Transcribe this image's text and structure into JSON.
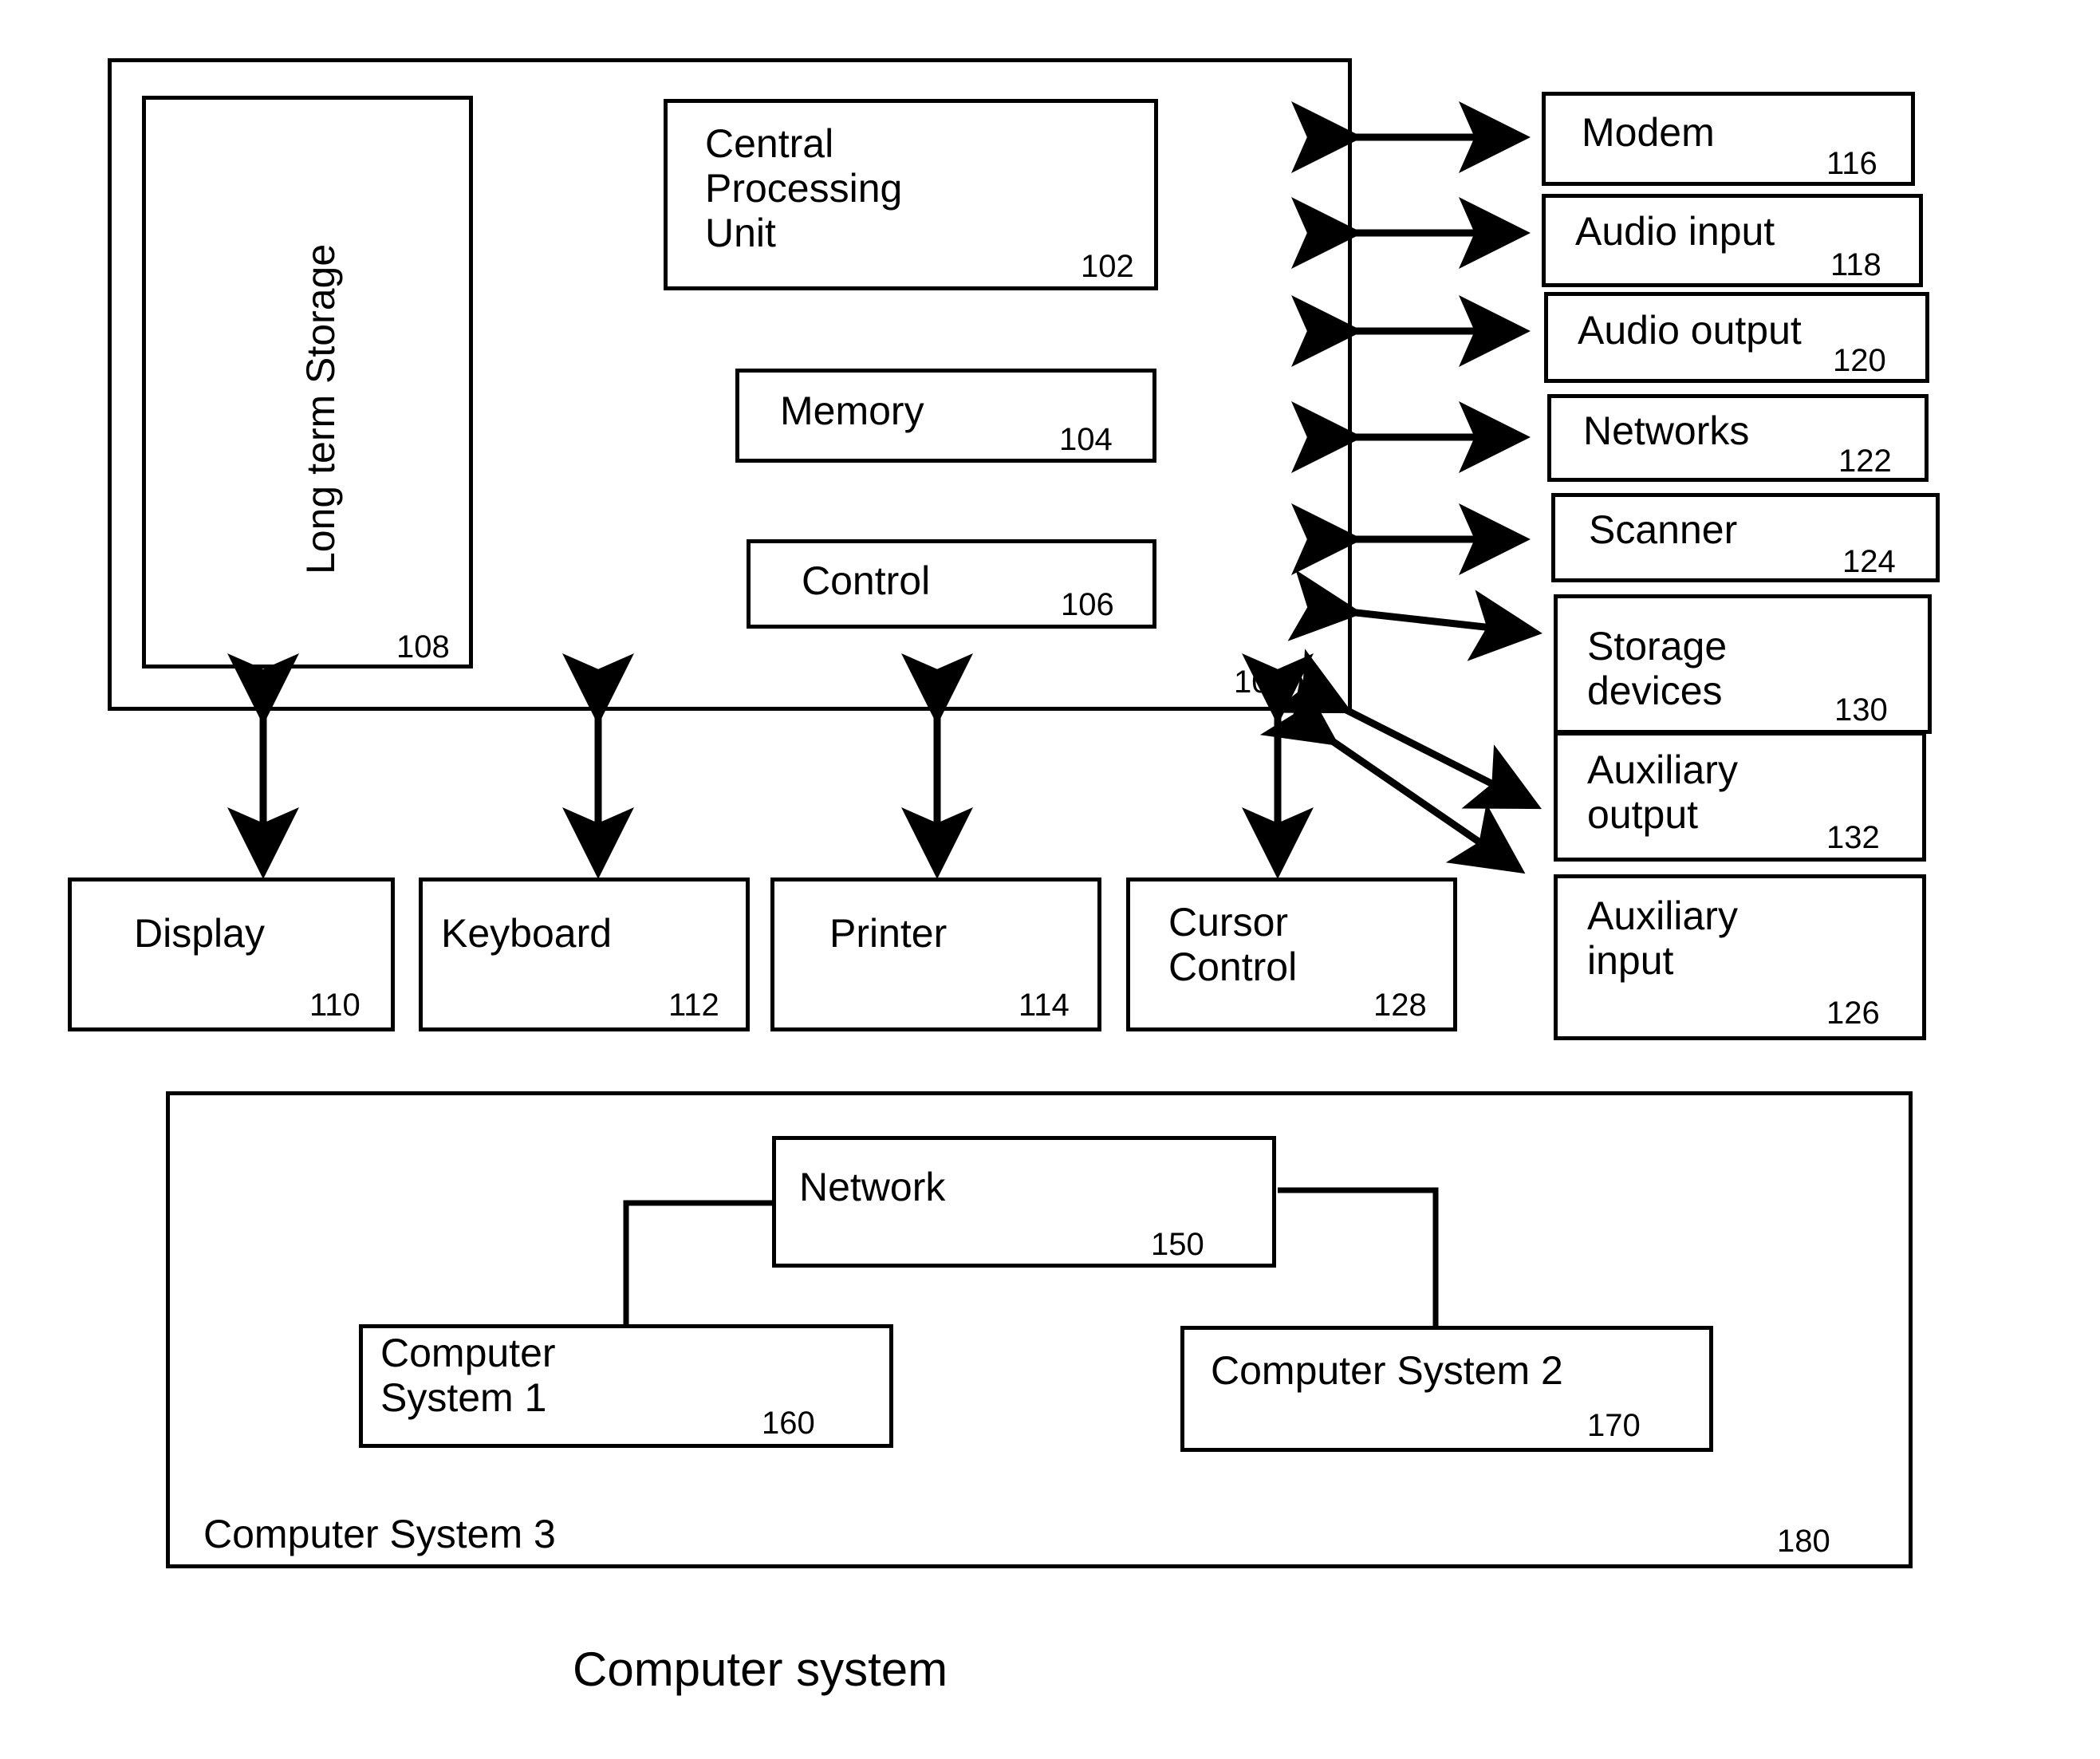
{
  "figure": {
    "title": "Computer system",
    "system_box": {
      "ref": "100"
    },
    "outer_box": {
      "label": "Computer System 3",
      "ref": "180"
    }
  },
  "internal_components": [
    {
      "id": "long-term-storage",
      "label": "Long term Storage",
      "ref": "108",
      "orientation": "vertical"
    },
    {
      "id": "central-processing-unit",
      "label": "Central\nProcessing\nUnit",
      "ref": "102",
      "orientation": "horizontal"
    },
    {
      "id": "memory",
      "label": "Memory",
      "ref": "104",
      "orientation": "horizontal"
    },
    {
      "id": "control",
      "label": "Control",
      "ref": "106",
      "orientation": "horizontal"
    }
  ],
  "peripherals_right": [
    {
      "id": "modem",
      "label": "Modem",
      "ref": "116"
    },
    {
      "id": "audio-input",
      "label": "Audio input",
      "ref": "118"
    },
    {
      "id": "audio-output",
      "label": "Audio output",
      "ref": "120"
    },
    {
      "id": "networks",
      "label": "Networks",
      "ref": "122"
    },
    {
      "id": "scanner",
      "label": "Scanner",
      "ref": "124"
    },
    {
      "id": "storage-devices",
      "label": "Storage\ndevices",
      "ref": "130"
    },
    {
      "id": "auxiliary-output",
      "label": "Auxiliary\noutput",
      "ref": "132"
    },
    {
      "id": "auxiliary-input",
      "label": "Auxiliary\ninput",
      "ref": "126"
    }
  ],
  "peripherals_bottom": [
    {
      "id": "display",
      "label": "Display",
      "ref": "110"
    },
    {
      "id": "keyboard",
      "label": "Keyboard",
      "ref": "112"
    },
    {
      "id": "printer",
      "label": "Printer",
      "ref": "114"
    },
    {
      "id": "cursor-control",
      "label": "Cursor\nControl",
      "ref": "128"
    }
  ],
  "network_section": {
    "network": {
      "id": "network",
      "label": "Network",
      "ref": "150"
    },
    "computer_system_1": {
      "id": "computer-system-1",
      "label": "Computer\nSystem 1",
      "ref": "160"
    },
    "computer_system_2": {
      "id": "computer-system-2",
      "label": "Computer System 2",
      "ref": "170"
    }
  },
  "colors": {
    "line": "#000000",
    "background": "#ffffff"
  }
}
